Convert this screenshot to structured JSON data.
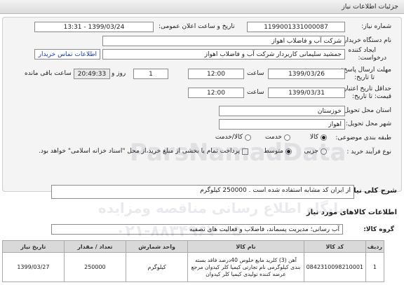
{
  "header": {
    "title": "جزئیات اطلاعات نیاز"
  },
  "form": {
    "need_number_label": "شماره نیاز:",
    "need_number": "1199001331000087",
    "announce_label": "تاریخ و ساعت اعلان عمومی:",
    "announce_value": "1399/03/24 - 13:31",
    "buyer_label": "نام دستگاه خریدار:",
    "buyer_value": "شرکت آب و فاضلاب اهواز",
    "creator_label_1": "ایجاد کننده",
    "creator_label_2": "درخواست:",
    "creator_value": "جمشید سلیمانی کاربردار شرکت آب و فاضلاب اهواز",
    "contact_link": "اطلاعات تماس خریدار",
    "deadline_label_1": "مهلت ارسال پاسخ:",
    "deadline_label_2": "تا تاریخ:",
    "deadline_date": "1399/03/26",
    "time_label": "ساعت",
    "deadline_time": "12:00",
    "days_value": "1",
    "days_label": "روز و",
    "remaining_time": "20:49:33",
    "remaining_label": "ساعت باقی مانده",
    "validity_label_1": "حداقل تاریخ اعتبار",
    "validity_label_2": "قیمت: تا تاریخ:",
    "validity_date": "1399/03/31",
    "validity_time_label": "ساعت",
    "validity_time": "12:00",
    "province_label": "استان محل تحویل:",
    "province_value": "خوزستان",
    "city_label": "شهر محل تحویل:",
    "city_value": "اهواز",
    "category_label": "طبقه بندی موضوعی:",
    "category_options": [
      "کالا",
      "خدمت",
      "کالا/خدمت"
    ],
    "category_selected": "کالا",
    "process_label": "نوع فرآیند خرید :",
    "process_options": [
      "جزیی",
      "متوسط"
    ],
    "process_selected": "متوسط",
    "payment_text": "پرداخت تمام یا بخشی از مبلغ خرید،از محل \"اسناد خزانه اسلامی\" خواهد بود."
  },
  "description": {
    "label": "شرح کلی نیاز:",
    "value": "از ایران کد مشابه استفاده شده است . 250000 کیلوگرم"
  },
  "items_section": {
    "title": "اطلاعات کالاهای مورد نیاز",
    "group_label": "گروه کالا:",
    "group_value": "آب رسانی؛ مدیریت پسماند، فاضلاب و فعالیت های تصفیه"
  },
  "table": {
    "headers": [
      "ردیف",
      "کد کالا",
      "نام کالا",
      "واحد شمارش",
      "تعداد / مقدار",
      "تاریخ نیاز"
    ],
    "rows": [
      {
        "row": "1",
        "code": "0842310098210001",
        "name": "آهن (3) کلرید مایع خلوص 40درصد فاقد بسته بندی کیلوگرمی نام تجارتی کیمیا کلر کیدوان مرجع عرضه کننده تولیدی کیمیا کلر کیدوان",
        "unit": "کیلوگرم",
        "qty": "250000",
        "date": "1399/03/27"
      }
    ]
  },
  "watermark": {
    "line1": "ParsNamadData",
    "line2": "پایگاه اطلاع رسانی مناقصه ومزایده",
    "line3": "۰۲۱-۸۸۳۴۹۶۷۰-۵"
  }
}
